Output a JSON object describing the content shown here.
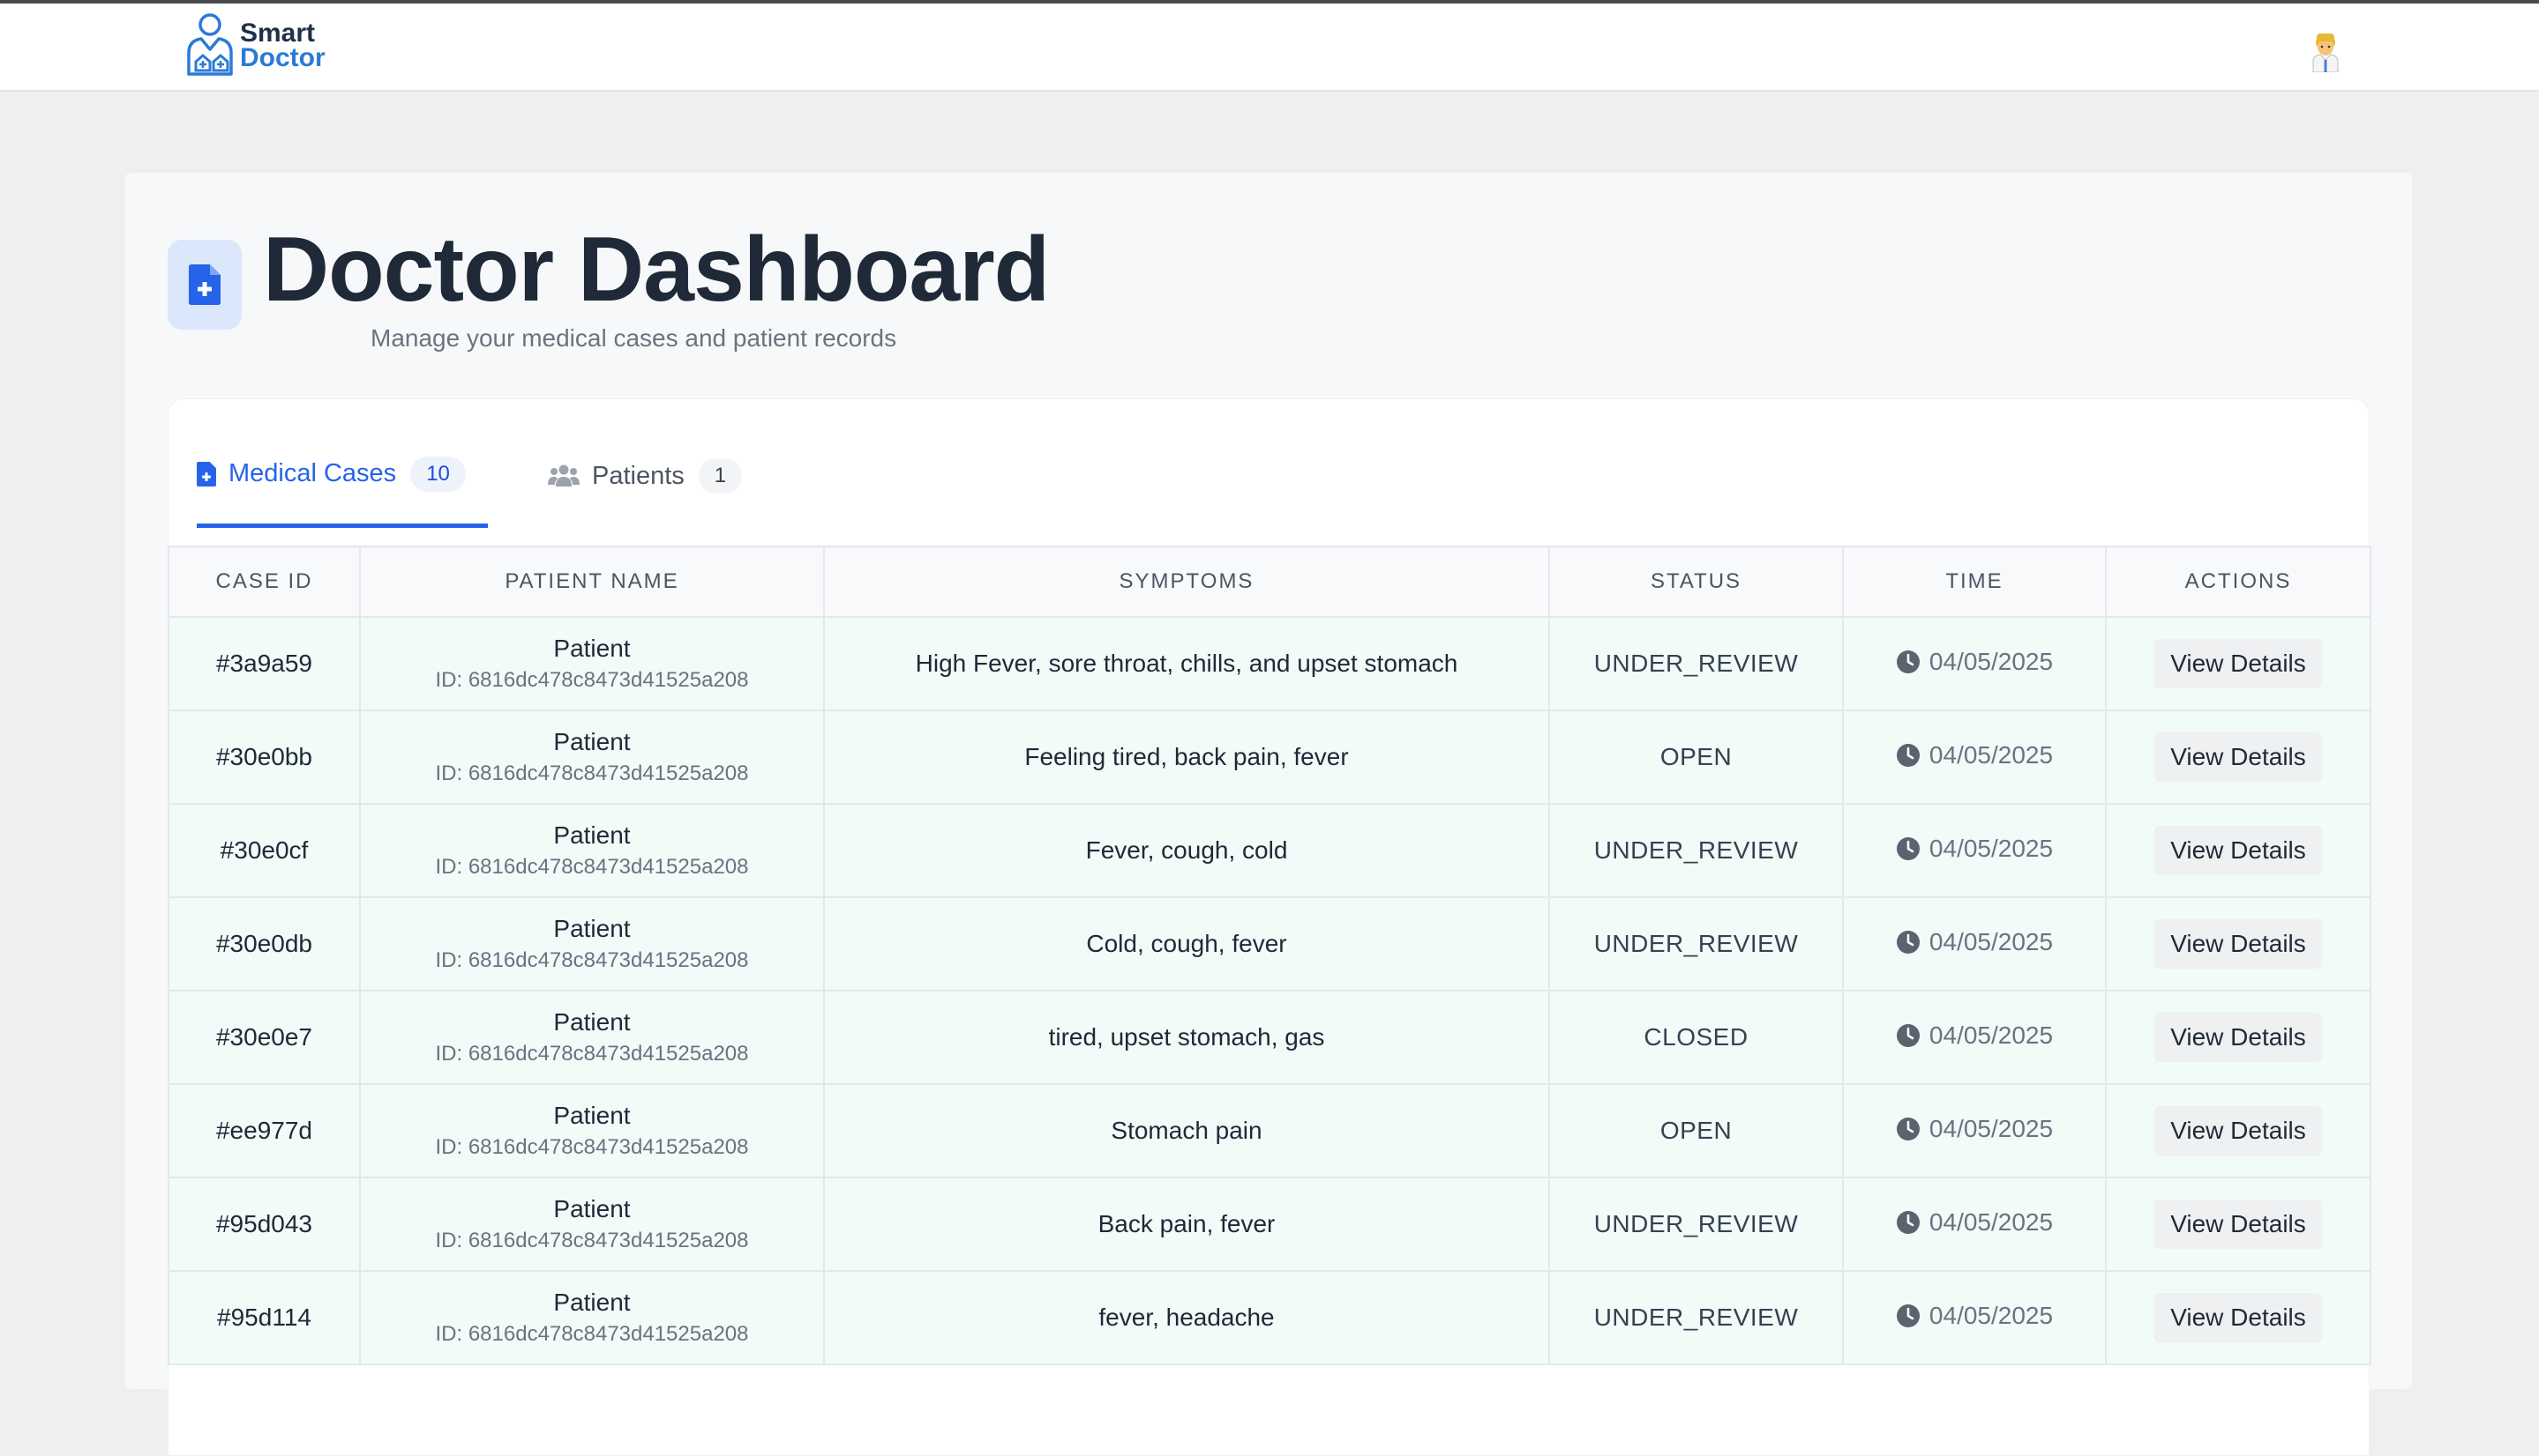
{
  "app": {
    "logo_line1": "Smart",
    "logo_line2": "Doctor"
  },
  "header": {
    "title": "Doctor Dashboard",
    "subtitle": "Manage your medical cases and patient records"
  },
  "tabs": [
    {
      "label": "Medical Cases",
      "count": "10",
      "active": true,
      "icon": "file-medical-icon"
    },
    {
      "label": "Patients",
      "count": "1",
      "active": false,
      "icon": "users-icon"
    }
  ],
  "table": {
    "columns": [
      "CASE ID",
      "PATIENT NAME",
      "SYMPTOMS",
      "STATUS",
      "TIME",
      "ACTIONS"
    ],
    "rows": [
      {
        "case_id": "#3a9a59",
        "patient": "Patient",
        "patient_id": "ID: 6816dc478c8473d41525a208",
        "symptoms": "High Fever, sore throat, chills, and upset stomach",
        "status": "UNDER_REVIEW",
        "time": "04/05/2025",
        "action": "View Details"
      },
      {
        "case_id": "#30e0bb",
        "patient": "Patient",
        "patient_id": "ID: 6816dc478c8473d41525a208",
        "symptoms": "Feeling tired, back pain, fever",
        "status": "OPEN",
        "time": "04/05/2025",
        "action": "View Details"
      },
      {
        "case_id": "#30e0cf",
        "patient": "Patient",
        "patient_id": "ID: 6816dc478c8473d41525a208",
        "symptoms": "Fever, cough, cold",
        "status": "UNDER_REVIEW",
        "time": "04/05/2025",
        "action": "View Details"
      },
      {
        "case_id": "#30e0db",
        "patient": "Patient",
        "patient_id": "ID: 6816dc478c8473d41525a208",
        "symptoms": "Cold, cough, fever",
        "status": "UNDER_REVIEW",
        "time": "04/05/2025",
        "action": "View Details"
      },
      {
        "case_id": "#30e0e7",
        "patient": "Patient",
        "patient_id": "ID: 6816dc478c8473d41525a208",
        "symptoms": "tired, upset stomach, gas",
        "status": "CLOSED",
        "time": "04/05/2025",
        "action": "View Details"
      },
      {
        "case_id": "#ee977d",
        "patient": "Patient",
        "patient_id": "ID: 6816dc478c8473d41525a208",
        "symptoms": "Stomach pain",
        "status": "OPEN",
        "time": "04/05/2025",
        "action": "View Details"
      },
      {
        "case_id": "#95d043",
        "patient": "Patient",
        "patient_id": "ID: 6816dc478c8473d41525a208",
        "symptoms": "Back pain, fever",
        "status": "UNDER_REVIEW",
        "time": "04/05/2025",
        "action": "View Details"
      },
      {
        "case_id": "#95d114",
        "patient": "Patient",
        "patient_id": "ID: 6816dc478c8473d41525a208",
        "symptoms": "fever, headache",
        "status": "UNDER_REVIEW",
        "time": "04/05/2025",
        "action": "View Details"
      }
    ]
  },
  "colors": {
    "accent": "#2563eb",
    "row_background": "#f1fbf8",
    "title": "#1f2937"
  }
}
